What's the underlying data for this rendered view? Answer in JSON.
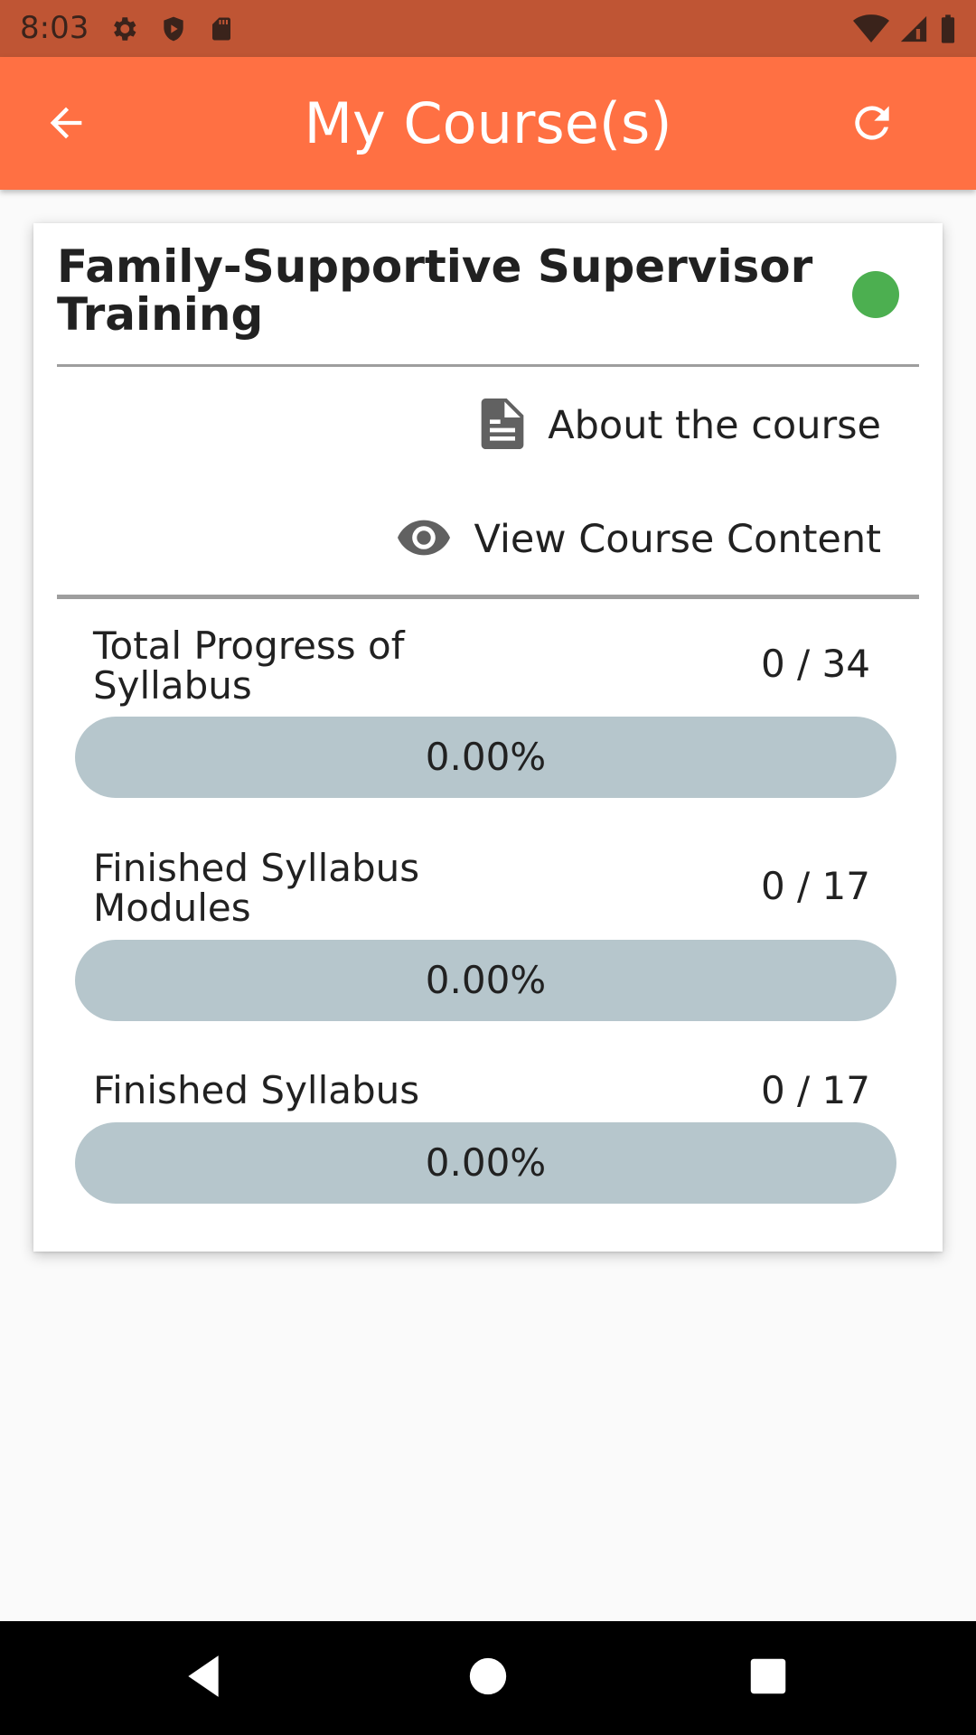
{
  "status_bar": {
    "time": "8:03",
    "left_icons": [
      "settings-icon",
      "shield-play-icon",
      "sd-card-icon"
    ],
    "right_icons": [
      "wifi-icon",
      "cell-signal-icon",
      "battery-icon"
    ]
  },
  "app_bar": {
    "title": "My Course(s)",
    "back_icon": "arrow-back-icon",
    "refresh_icon": "refresh-icon",
    "background_color": "#ff7043"
  },
  "course": {
    "title": "Family-Supportive Supervisor Training",
    "status_color": "#4caf50",
    "actions": {
      "about": {
        "label": "About the course",
        "icon": "document-icon"
      },
      "view": {
        "label": "View Course Content",
        "icon": "eye-icon"
      }
    },
    "progress": [
      {
        "label": "Total Progress of Syllabus",
        "count": "0 / 34",
        "percent_text": "0.00%",
        "fraction": 0
      },
      {
        "label": "Finished Syllabus Modules",
        "count": "0 / 17",
        "percent_text": "0.00%",
        "fraction": 0
      },
      {
        "label": "Finished Syllabus",
        "count": "0 / 17",
        "percent_text": "0.00%",
        "fraction": 0
      }
    ]
  },
  "nav_bar": {
    "buttons": [
      "back-triangle-icon",
      "home-circle-icon",
      "recents-square-icon"
    ]
  }
}
